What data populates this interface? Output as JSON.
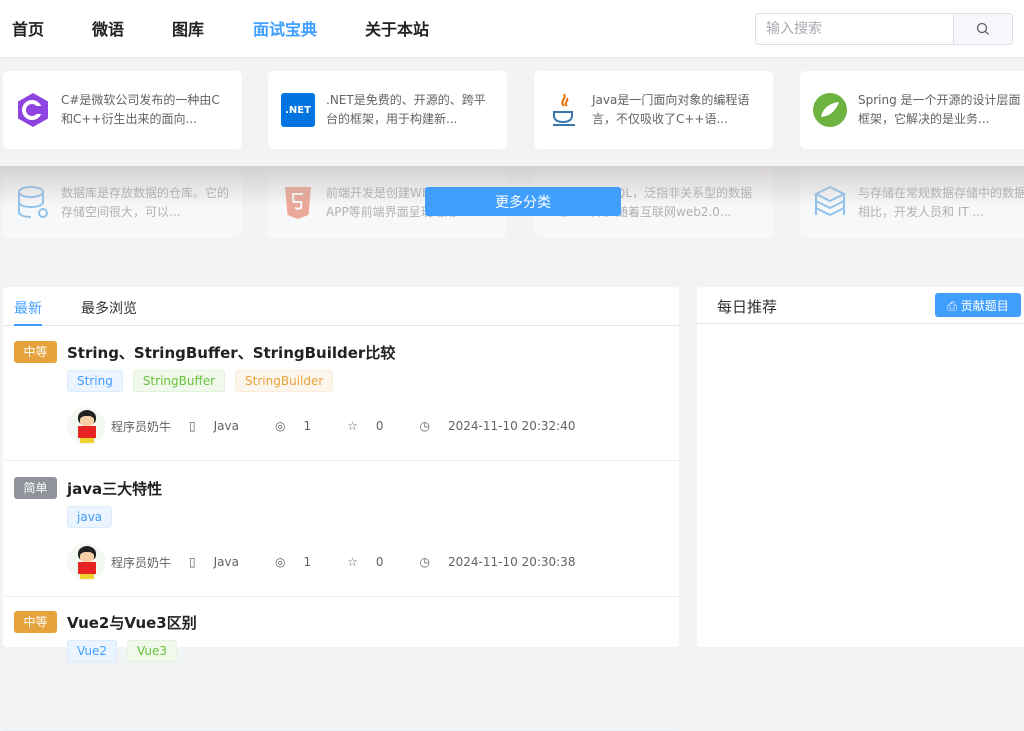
{
  "nav": [
    "首页",
    "微语",
    "图库",
    "面试宝典",
    "关于本站"
  ],
  "search": {
    "placeholder": "输入搜索"
  },
  "categories": [
    {
      "icon": "csharp-icon",
      "text": "C#是微软公司发布的一种由C和C++衍生出来的面向..."
    },
    {
      "icon": "dotnet-icon",
      "label": ".NET",
      "text": ".NET是免费的、开源的、跨平台的框架，用于构建新..."
    },
    {
      "icon": "java-icon",
      "text": "Java是一门面向对象的编程语言，不仅吸收了C++语..."
    },
    {
      "icon": "spring-icon",
      "text": "Spring 是一个开源的设计层面框架，它解决的是业务..."
    },
    {
      "icon": "database-icon",
      "text": "数据库是存放数据的仓库。它的存储空间很大，可以..."
    },
    {
      "icon": "html5-icon",
      "text": "前端开发是创建WEB页面或APP等前端界面呈现给用..."
    },
    {
      "icon": "nosql-icon",
      "text": "NoSQL，泛指非关系型的数据库。随着互联网web2.0..."
    },
    {
      "icon": "storage-icon",
      "text": "与存储在常规数据存储中的数据相比，开发人员和 IT ..."
    }
  ],
  "more_label": "更多分类",
  "tabs": [
    "最新",
    "最多浏览"
  ],
  "items": [
    {
      "level": "中等",
      "level_color": "#e6a23c",
      "title": "String、StringBuffer、StringBuilder比较",
      "tags": [
        "String",
        "StringBuffer",
        "StringBuilder"
      ],
      "author": "程序员奶牛",
      "category": "Java",
      "views": "1",
      "stars": "0",
      "time": "2024-11-10 20:32:40"
    },
    {
      "level": "简单",
      "level_color": "#909399",
      "title": "java三大特性",
      "tags": [
        "java"
      ],
      "author": "程序员奶牛",
      "category": "Java",
      "views": "1",
      "stars": "0",
      "time": "2024-11-10 20:30:38"
    },
    {
      "level": "中等",
      "level_color": "#e6a23c",
      "title": "Vue2与Vue3区别",
      "tags": [
        "Vue2",
        "Vue3"
      ]
    }
  ],
  "side": {
    "title": "每日推荐",
    "contribute_label": "贡献题目"
  }
}
